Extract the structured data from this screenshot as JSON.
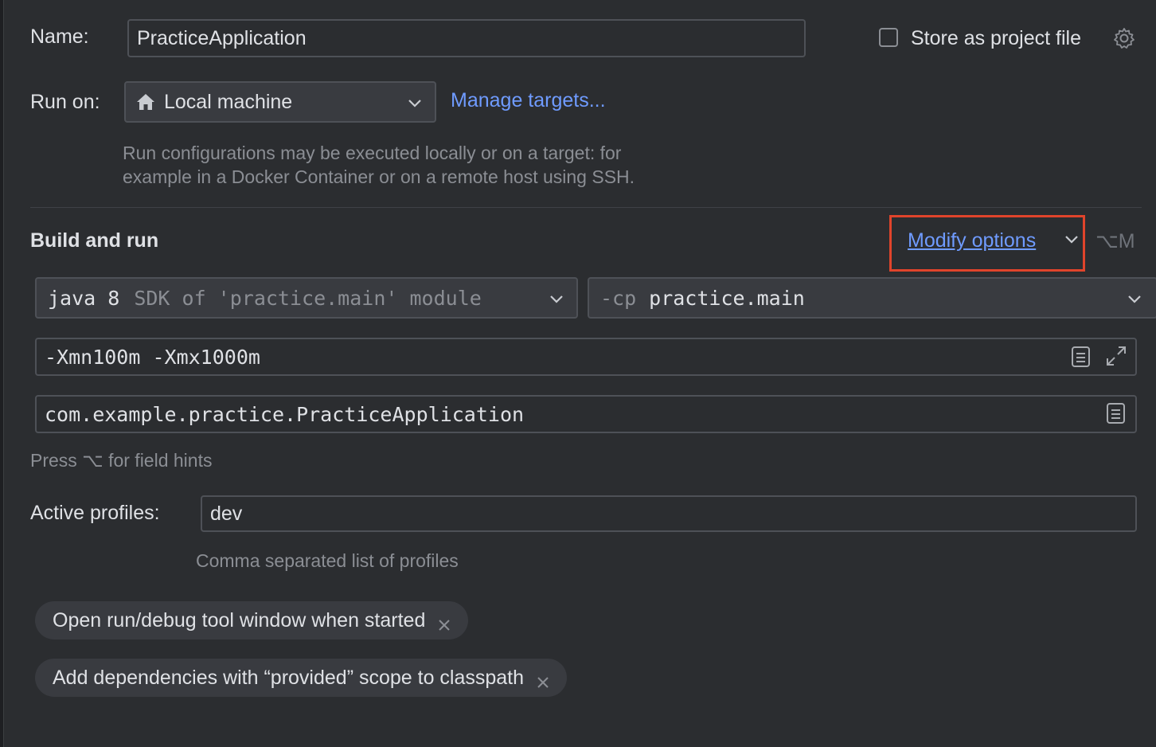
{
  "name": {
    "label": "Name:",
    "value": "PracticeApplication"
  },
  "store": {
    "label": "Store as project file",
    "checked": false
  },
  "run_on": {
    "label": "Run on:",
    "value": "Local machine",
    "manage_link": "Manage targets...",
    "hint_line1": "Run configurations may be executed locally or on a target: for",
    "hint_line2": "example in a Docker Container or on a remote host using SSH."
  },
  "build": {
    "title": "Build and run",
    "modify_link": "Modify options",
    "modify_shortcut": "⌥M",
    "jre_main": "java 8",
    "jre_secondary": "SDK of 'practice.main' module",
    "cp_prefix": "-cp",
    "cp_value": "practice.main",
    "vm_options": "-Xmn100m -Xmx1000m",
    "main_class": "com.example.practice.PracticeApplication",
    "field_hint": "Press ⌥ for field hints"
  },
  "profiles": {
    "label": "Active profiles:",
    "value": "dev",
    "hint": "Comma separated list of profiles"
  },
  "chips": [
    {
      "label": "Open run/debug tool window when started"
    },
    {
      "label": "Add dependencies with “provided” scope to classpath"
    }
  ],
  "colors": {
    "background": "#2b2d30",
    "link": "#6f9bff",
    "highlight_box": "#e0442b",
    "hint": "#8b8e94"
  }
}
